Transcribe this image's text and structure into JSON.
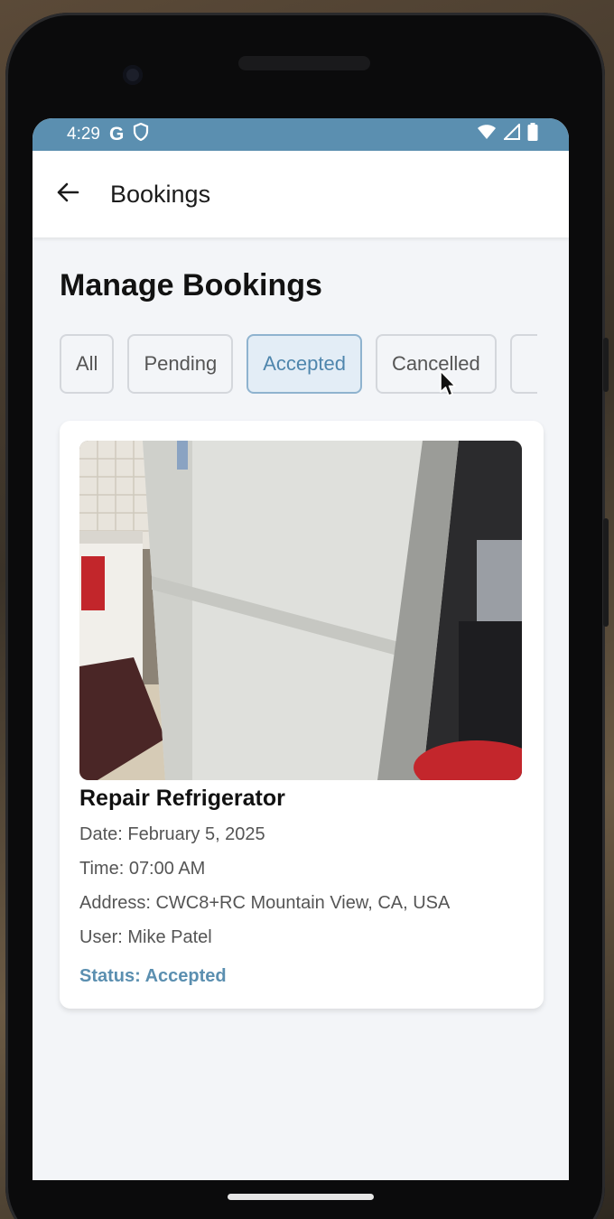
{
  "status_bar": {
    "time": "4:29",
    "left_icons": [
      "google-g-icon",
      "shield-icon"
    ],
    "right_icons": [
      "wifi-icon",
      "signal-icon",
      "battery-icon"
    ],
    "g_letter": "G"
  },
  "app_bar": {
    "title": "Bookings",
    "back_icon": "arrow-left-icon"
  },
  "page": {
    "title": "Manage Bookings"
  },
  "filters": {
    "items": [
      {
        "label": "All",
        "active": false
      },
      {
        "label": "Pending",
        "active": false
      },
      {
        "label": "Accepted",
        "active": true
      },
      {
        "label": "Cancelled",
        "active": false
      }
    ],
    "selected": "Accepted"
  },
  "booking": {
    "title": "Repair Refrigerator",
    "date": "Date: February 5, 2025",
    "time": "Time: 07:00 AM",
    "address": "Address: CWC8+RC Mountain View, CA, USA",
    "user": "User: Mike Patel",
    "status": "Status: Accepted"
  },
  "colors": {
    "accent": "#5b8fb0",
    "chip_active_bg": "#e3edf6",
    "chip_active_border": "#8fb3cf",
    "screen_bg": "#f3f5f8"
  }
}
